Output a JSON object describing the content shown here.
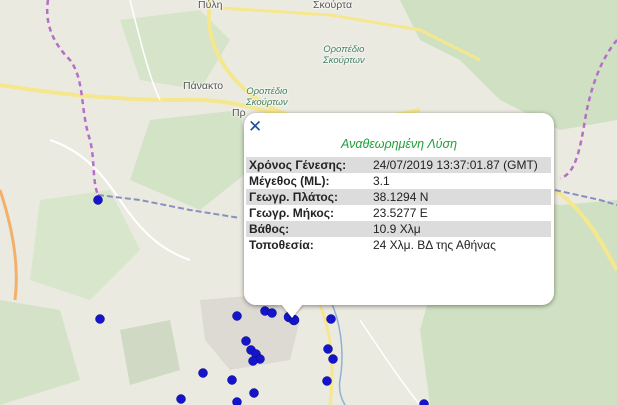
{
  "map": {
    "places": [
      {
        "id": "pyli",
        "name": "Πύλη"
      },
      {
        "id": "skourta",
        "name": "Σκούρτα"
      },
      {
        "id": "panakto",
        "name": "Πάνακτο"
      },
      {
        "id": "pro",
        "name": "Πρ"
      }
    ],
    "plateaus": [
      {
        "id": "oropedio1",
        "line1": "Οροπέδιο",
        "line2": "Σκούρτων"
      },
      {
        "id": "oropedio2",
        "line1": "Οροπέδιο",
        "line2": "Σκούρτων"
      }
    ],
    "colors": {
      "land": "#eaeae2",
      "forest": "#cfe0c0",
      "road": "#f2e68c",
      "border": "#b06ac4",
      "river": "#8ab0d8",
      "marker": "#1414cc"
    },
    "earthquake_marker_count": 22
  },
  "popup": {
    "close_icon": "close-icon",
    "close_symbol": "✕",
    "title": "Αναθεωρημένη Λύση",
    "rows": [
      {
        "label": "Χρόνος Γένεσης:",
        "value": "24/07/2019 13:37:01.87 (GMT)"
      },
      {
        "label": "Μέγεθος (ML):",
        "value": "3.1"
      },
      {
        "label": "Γεωγρ. Πλάτος:",
        "value": "38.1294 N"
      },
      {
        "label": "Γεωγρ. Μήκος:",
        "value": "23.5277 E"
      },
      {
        "label": "Βάθος:",
        "value": "10.9 Χλμ"
      },
      {
        "label": "Τοποθεσία:",
        "value": "24 Χλμ. ΒΔ της Αθήνας"
      }
    ]
  }
}
